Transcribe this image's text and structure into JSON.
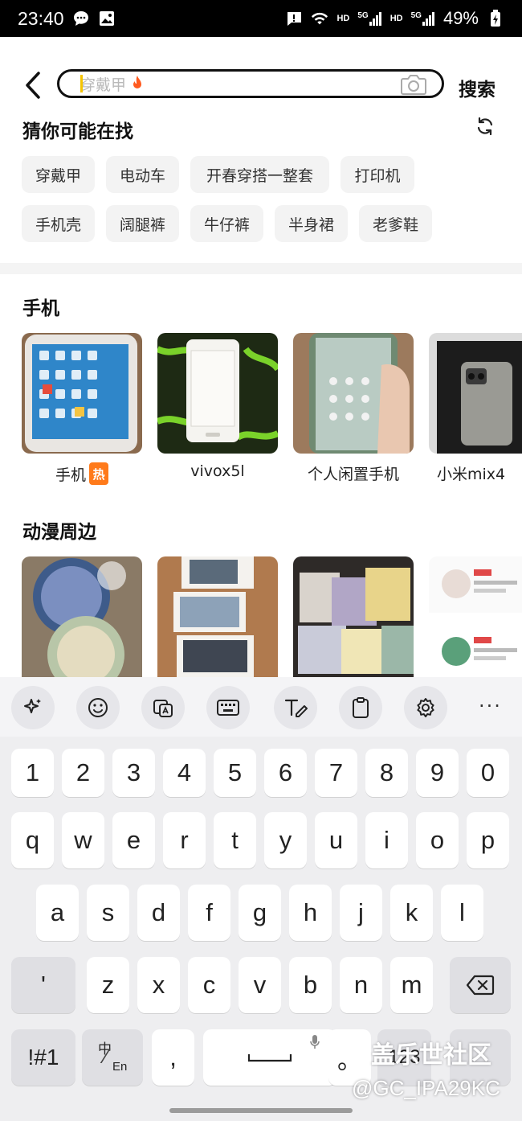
{
  "status_bar": {
    "time": "23:40",
    "hd1": "HD",
    "net1": "5G",
    "hd2": "HD",
    "net2": "5G",
    "battery": "49%"
  },
  "search": {
    "placeholder": "穿戴甲",
    "button_label": "搜索",
    "caret_color": "#f5c400",
    "fire_color": "#ff5a1f"
  },
  "guess": {
    "title": "猜你可能在找",
    "chips_row1": [
      "穿戴甲",
      "电动车",
      "开春穿搭一整套",
      "打印机"
    ],
    "chips_row2": [
      "手机壳",
      "阔腿裤",
      "牛仔裤",
      "半身裙",
      "老爹鞋"
    ]
  },
  "sections": [
    {
      "title": "手机",
      "items": [
        {
          "caption": "手机",
          "hot": "热",
          "icon": "android-phone-photo"
        },
        {
          "caption": "vivox5l",
          "hot": "",
          "icon": "white-phone-photo"
        },
        {
          "caption": "个人闲置手机",
          "hot": "",
          "icon": "phone-in-hand-photo"
        },
        {
          "caption": "小米mix4",
          "hot": "",
          "icon": "boxed-phone-photo"
        }
      ]
    },
    {
      "title": "动漫周边",
      "items": [
        {
          "caption": "",
          "icon": "anime-badges-photo"
        },
        {
          "caption": "",
          "icon": "anime-photo-cards-photo"
        },
        {
          "caption": "",
          "icon": "anime-shikishi-photo"
        },
        {
          "caption": "",
          "icon": "anime-listing-screenshot"
        }
      ]
    }
  ],
  "keyboard": {
    "toolbar": [
      "sparkle-icon",
      "emoji-icon",
      "translate-icon",
      "keyboard-icon",
      "handwriting-icon",
      "clipboard-icon",
      "settings-icon"
    ],
    "more": "···",
    "row_numbers": [
      "1",
      "2",
      "3",
      "4",
      "5",
      "6",
      "7",
      "8",
      "9",
      "0"
    ],
    "row1": [
      "q",
      "w",
      "e",
      "r",
      "t",
      "y",
      "u",
      "i",
      "o",
      "p"
    ],
    "row2": [
      "a",
      "s",
      "d",
      "f",
      "g",
      "h",
      "j",
      "k",
      "l"
    ],
    "row3": [
      "'",
      "z",
      "x",
      "c",
      "v",
      "b",
      "n",
      "m"
    ],
    "symbols": "!#1",
    "lang_top": "中",
    "lang_bottom": "En",
    "comma": ",",
    "period": "。",
    "enter_partial": "123"
  },
  "watermark": {
    "line1": "盖乐世社区",
    "line2": "@GC_IPA29KC"
  }
}
